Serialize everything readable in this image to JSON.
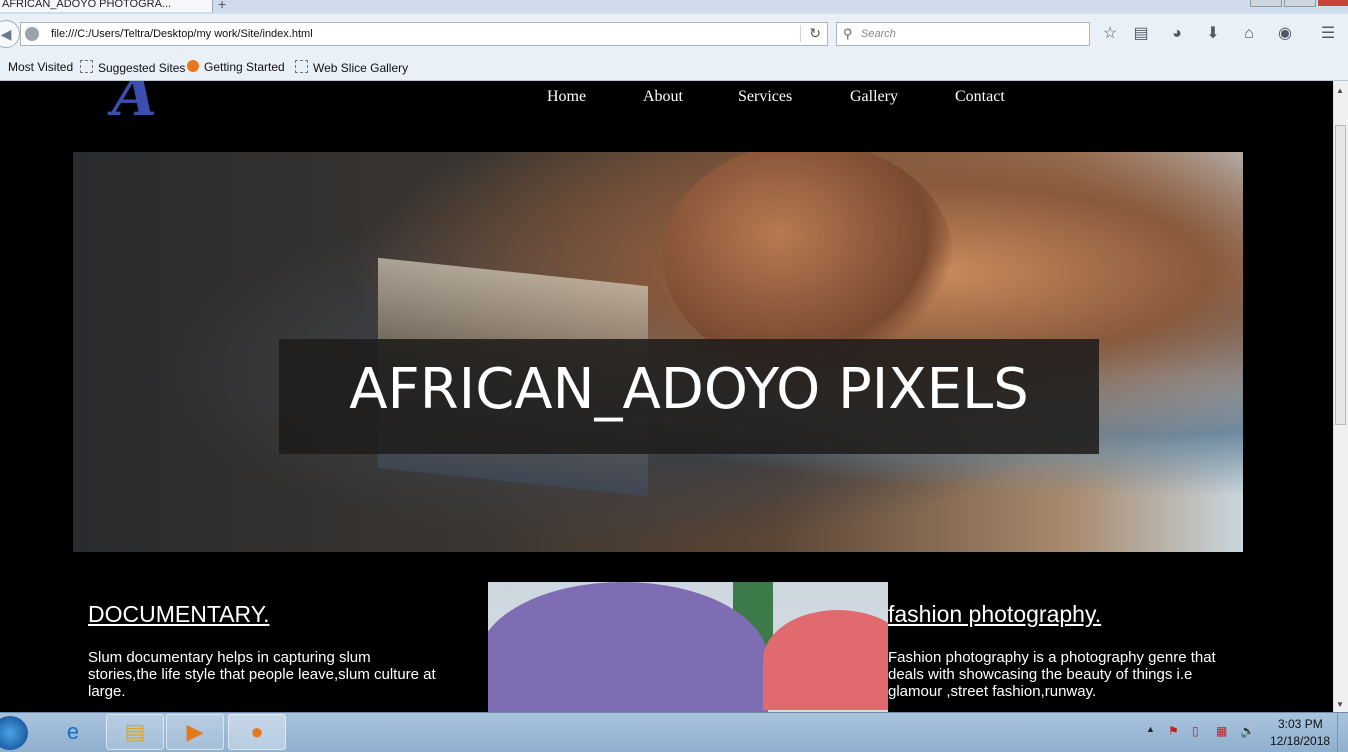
{
  "browser": {
    "tab_title": "AFRICAN_ADOYO PHOTOGRA...",
    "new_tab_symbol": "+",
    "url": "file:///C:/Users/Teltra/Desktop/my work/Site/index.html",
    "search_placeholder": "Search",
    "bookmarks": [
      "Most Visited",
      "Suggested Sites",
      "Getting Started",
      "Web Slice Gallery"
    ],
    "toolbar_icons": [
      "bookmark-star-icon",
      "reading-list-icon",
      "pocket-icon",
      "download-icon",
      "home-icon",
      "chat-icon",
      "menu-icon"
    ]
  },
  "site": {
    "logo_letter": "A",
    "nav": [
      "Home",
      "About",
      "Services",
      "Gallery",
      "Contact"
    ],
    "hero_title": "AFRICAN_ADOYO PIXELS",
    "sections": [
      {
        "title": "DOCUMENTARY.",
        "body": "Slum documentary helps in capturing slum stories,the life style that people leave,slum culture at large."
      },
      {
        "title": "fashion photography.",
        "body": "Fashion photography is a photography genre that deals with showcasing the beauty of things i.e glamour ,street fashion,runway."
      }
    ]
  },
  "taskbar": {
    "time": "3:03 PM",
    "date": "12/18/2018",
    "tray_arrow": "▲"
  }
}
